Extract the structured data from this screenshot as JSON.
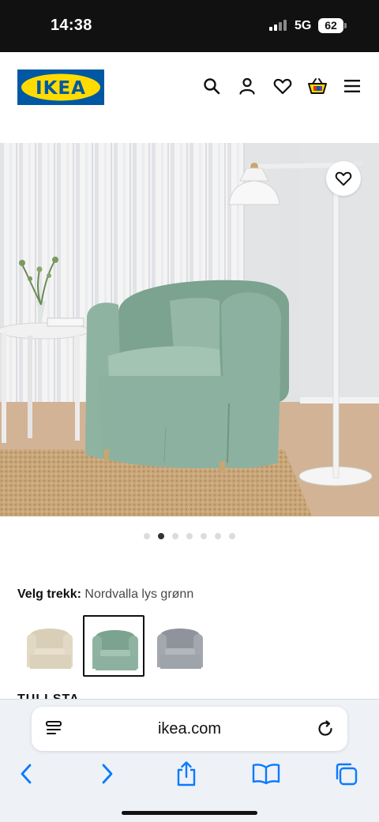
{
  "status_bar": {
    "time": "14:38",
    "network": "5G",
    "battery": "62"
  },
  "header": {
    "logo_text": "IKEA",
    "icons": [
      "search-icon",
      "user-icon",
      "heart-icon",
      "shopping-bag-icon",
      "menu-icon"
    ]
  },
  "gallery": {
    "image_count": 7,
    "active_index": 1
  },
  "cover": {
    "label": "Velg trekk:",
    "value": "Nordvalla lys grønn",
    "options": [
      {
        "color": "#d9cfb8"
      },
      {
        "color": "#8fb3a1",
        "selected": true
      },
      {
        "color": "#9fa3aa"
      }
    ]
  },
  "product": {
    "name": "TULLSTA"
  },
  "browser": {
    "url": "ikea.com",
    "accent_color": "#0a7aff"
  },
  "colors": {
    "ikea_blue": "#0058a3",
    "ikea_yellow": "#ffdb00"
  }
}
